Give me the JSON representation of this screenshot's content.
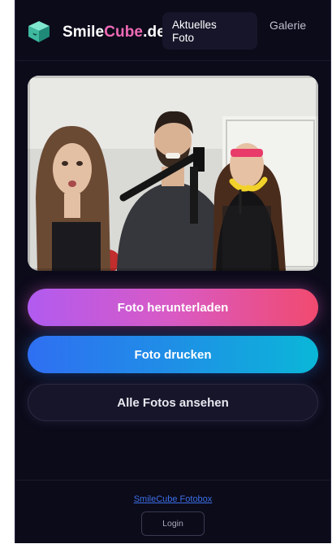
{
  "header": {
    "brand_prefix": "Smile",
    "brand_accent": "Cube",
    "brand_suffix": ".de",
    "tab_current_line1": "Aktuelles",
    "tab_current_line2": "Foto",
    "tab_gallery": "Galerie",
    "logo_icon": "cube-icon"
  },
  "actions": {
    "download_label": "Foto herunterladen",
    "print_label": "Foto drucken",
    "all_photos_label": "Alle Fotos ansehen"
  },
  "footer": {
    "link_text": "SmileCube Fotobox",
    "login_label": "Login"
  },
  "colors": {
    "background": "#0c0b1a",
    "brand_accent": "#f06bb6",
    "download_gradient": [
      "#b15bf0",
      "#f14a6f"
    ],
    "print_gradient": [
      "#2f6ff2",
      "#0ab7d8"
    ],
    "footer_link": "#3b6fe6"
  }
}
